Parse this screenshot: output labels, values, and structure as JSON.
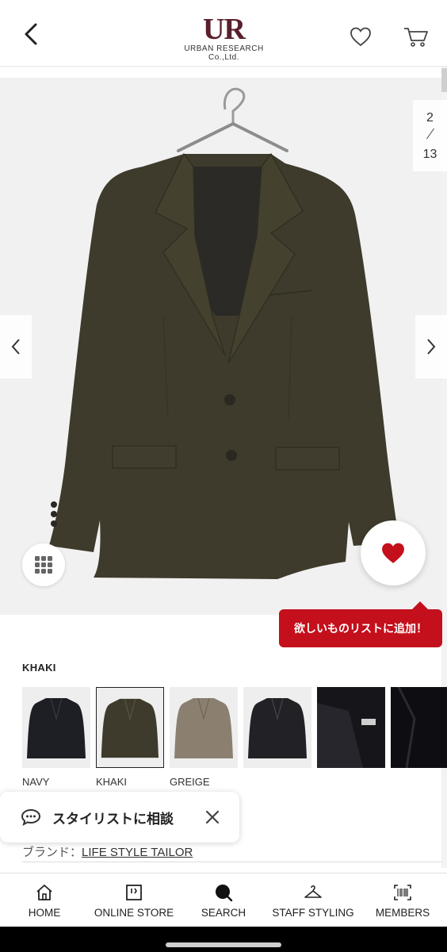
{
  "header": {
    "logo_mark": "UR",
    "logo_sub": "URBAN RESEARCH Co.,Ltd."
  },
  "gallery": {
    "current": "2",
    "total": "13"
  },
  "wish_tooltip": "欲しいものリストに追加！",
  "color": {
    "selected_label": "KHAKI",
    "swatches": [
      {
        "name": "NAVY",
        "fill": "#1e1f24"
      },
      {
        "name": "KHAKI",
        "fill": "#3e3b2c"
      },
      {
        "name": "GREIGE",
        "fill": "#8b8070"
      },
      {
        "name": "",
        "fill": "#222226"
      },
      {
        "name": "",
        "fill": "#15151a"
      },
      {
        "name": "",
        "fill": "#0e0e12"
      }
    ]
  },
  "consult": {
    "label": "スタイリストに相談"
  },
  "brand": {
    "prefix": "ブランド：",
    "name": "LIFE STYLE TAILOR"
  },
  "bottom_nav": [
    "HOME",
    "ONLINE STORE",
    "SEARCH",
    "STAFF STYLING",
    "MEMBERS"
  ],
  "colors": {
    "accent_red": "#c4101c",
    "logo_maroon": "#5a1f2b",
    "jacket_khaki": "#3e3b2c"
  }
}
